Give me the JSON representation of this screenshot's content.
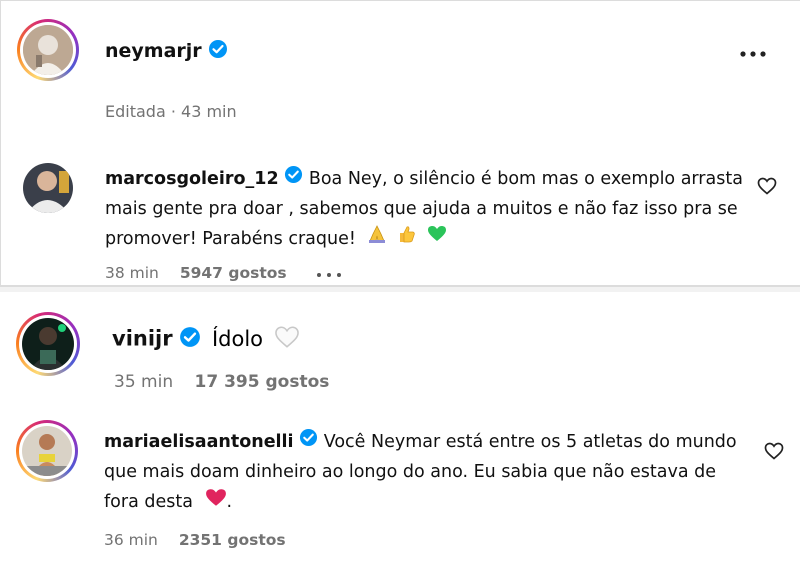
{
  "post": {
    "username": "neymarjr",
    "more_icon": "more-options-icon",
    "edited_label": "Editada · 43 min"
  },
  "comments": [
    {
      "username": "marcosgoleiro_12",
      "text": "Boa Ney, o silêncio é bom mas o exemplo arrasta mais gente pra doar , sabemos que ajuda a muitos e não faz isso pra se promover! Parabéns craque!",
      "emojis": [
        "pray-emoji",
        "thumbs-up-emoji",
        "green-heart-emoji"
      ],
      "time": "38 min",
      "likes": "5947 gostos",
      "more_icon": "more-dots-icon"
    },
    {
      "username": "vinijr",
      "text": "Ídolo",
      "time": "35 min",
      "likes": "17 395 gostos"
    },
    {
      "username": "mariaelisaantonelli",
      "text": "Você Neymar está entre os 5 atletas do mundo que mais doam dinheiro ao longo do ano. Eu sabia que não estava de fora desta",
      "emojis": [
        "red-heart-emoji"
      ],
      "text_end": ".",
      "time": "36 min",
      "likes": "2351 gostos"
    }
  ],
  "colors": {
    "verified": "#0095f6",
    "meta": "#737373",
    "green_heart": "#2bc45a",
    "red_heart": "#e0245e"
  }
}
